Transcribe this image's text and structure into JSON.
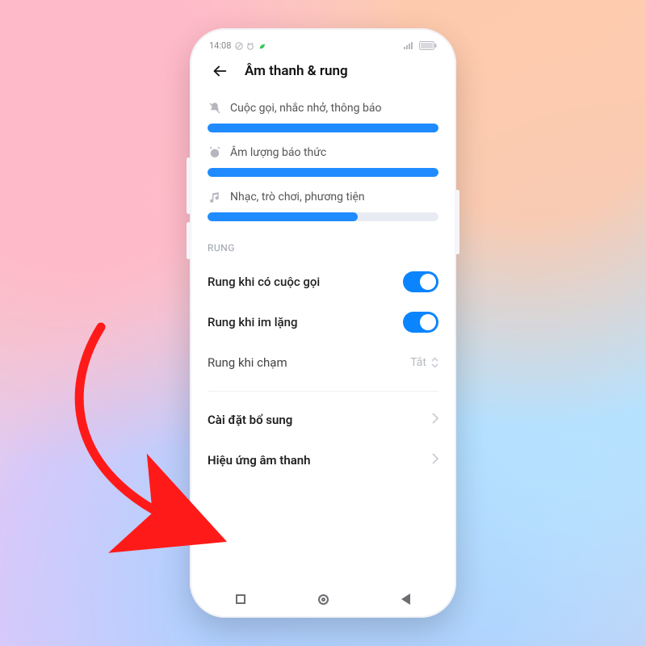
{
  "status": {
    "time": "14:08",
    "icons": [
      "dnd",
      "alarm",
      "leaf"
    ],
    "battery_label": ""
  },
  "header": {
    "title": "Âm thanh & rung"
  },
  "sliders": [
    {
      "icon": "bell-off",
      "label": "Cuộc gọi, nhắc nhở, thông báo",
      "value": 100
    },
    {
      "icon": "alarm",
      "label": "Âm lượng báo thức",
      "value": 100
    },
    {
      "icon": "music",
      "label": "Nhạc, trò chơi, phương tiện",
      "value": 65
    }
  ],
  "section_vibrate_title": "RUNG",
  "vibrate_rows": [
    {
      "label": "Rung khi có cuộc gọi",
      "on": true
    },
    {
      "label": "Rung khi im lặng",
      "on": true
    }
  ],
  "touch_row": {
    "label": "Rung khi chạm",
    "value": "Tắt"
  },
  "links": [
    {
      "label": "Cài đặt bổ sung"
    },
    {
      "label": "Hiệu ứng âm thanh"
    }
  ],
  "colors": {
    "accent": "#0b84ff"
  }
}
